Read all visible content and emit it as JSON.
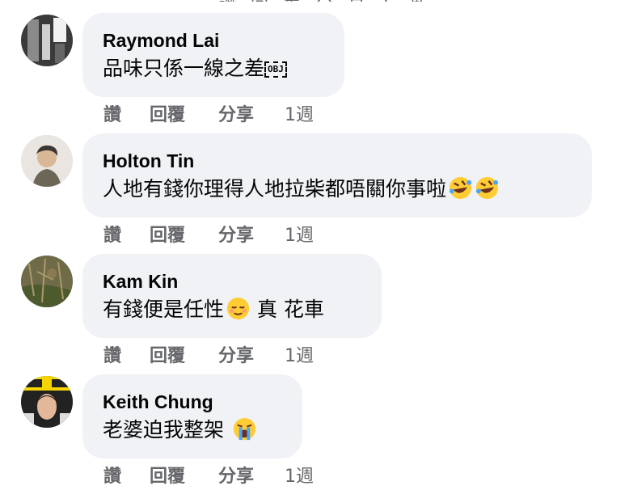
{
  "comments": [
    {
      "author": "Raymond Lai",
      "text": "品味只係一線之差",
      "trailing_glyph": "OBJ",
      "emojis": [],
      "actions": {
        "like": "讚",
        "reply": "回覆",
        "share": "分享",
        "time": "1週"
      }
    },
    {
      "author": "Holton Tin",
      "text": "人地有錢你理得人地拉柴都唔關你事啦",
      "emojis": [
        "rolling-laughing-emoji",
        "rolling-laughing-emoji"
      ],
      "actions": {
        "like": "讚",
        "reply": "回覆",
        "share": "分享",
        "time": "1週"
      }
    },
    {
      "author": "Kam Kin",
      "text": "有錢便是任性",
      "text_after": " 真 花車",
      "emojis": [
        "relieved-face-emoji"
      ],
      "actions": {
        "like": "讚",
        "reply": "回覆",
        "share": "分享",
        "time": "1週"
      }
    },
    {
      "author": "Keith Chung",
      "text": "老婆迫我整架 ",
      "emojis": [
        "loudly-crying-emoji"
      ],
      "actions": {
        "like": "讚",
        "reply": "回覆",
        "share": "分享",
        "time": "1週"
      }
    }
  ],
  "colors": {
    "bubble": "#f0f2f5",
    "action_text": "#65676b",
    "text": "#050505",
    "emoji_yellow": "#ffcc33"
  }
}
